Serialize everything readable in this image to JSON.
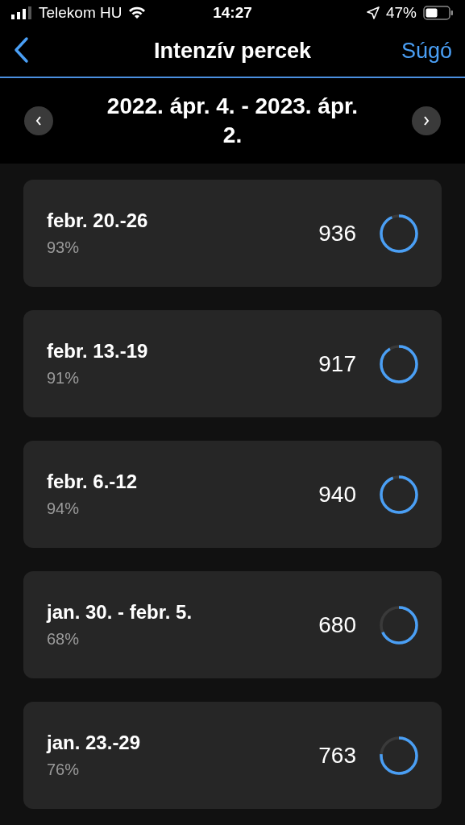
{
  "status_bar": {
    "carrier": "Telekom HU",
    "time": "14:27",
    "battery": "47%"
  },
  "nav": {
    "title": "Intenzív percek",
    "action": "Súgó"
  },
  "period": {
    "label": "2022. ápr. 4. - 2023. ápr. 2."
  },
  "weeks": [
    {
      "range": "febr. 20.-26",
      "percent": "93%",
      "minutes": "936"
    },
    {
      "range": "febr. 13.-19",
      "percent": "91%",
      "minutes": "917"
    },
    {
      "range": "febr. 6.-12",
      "percent": "94%",
      "minutes": "940"
    },
    {
      "range": "jan. 30. - febr. 5.",
      "percent": "68%",
      "minutes": "680"
    },
    {
      "range": "jan. 23.-29",
      "percent": "76%",
      "minutes": "763"
    }
  ]
}
